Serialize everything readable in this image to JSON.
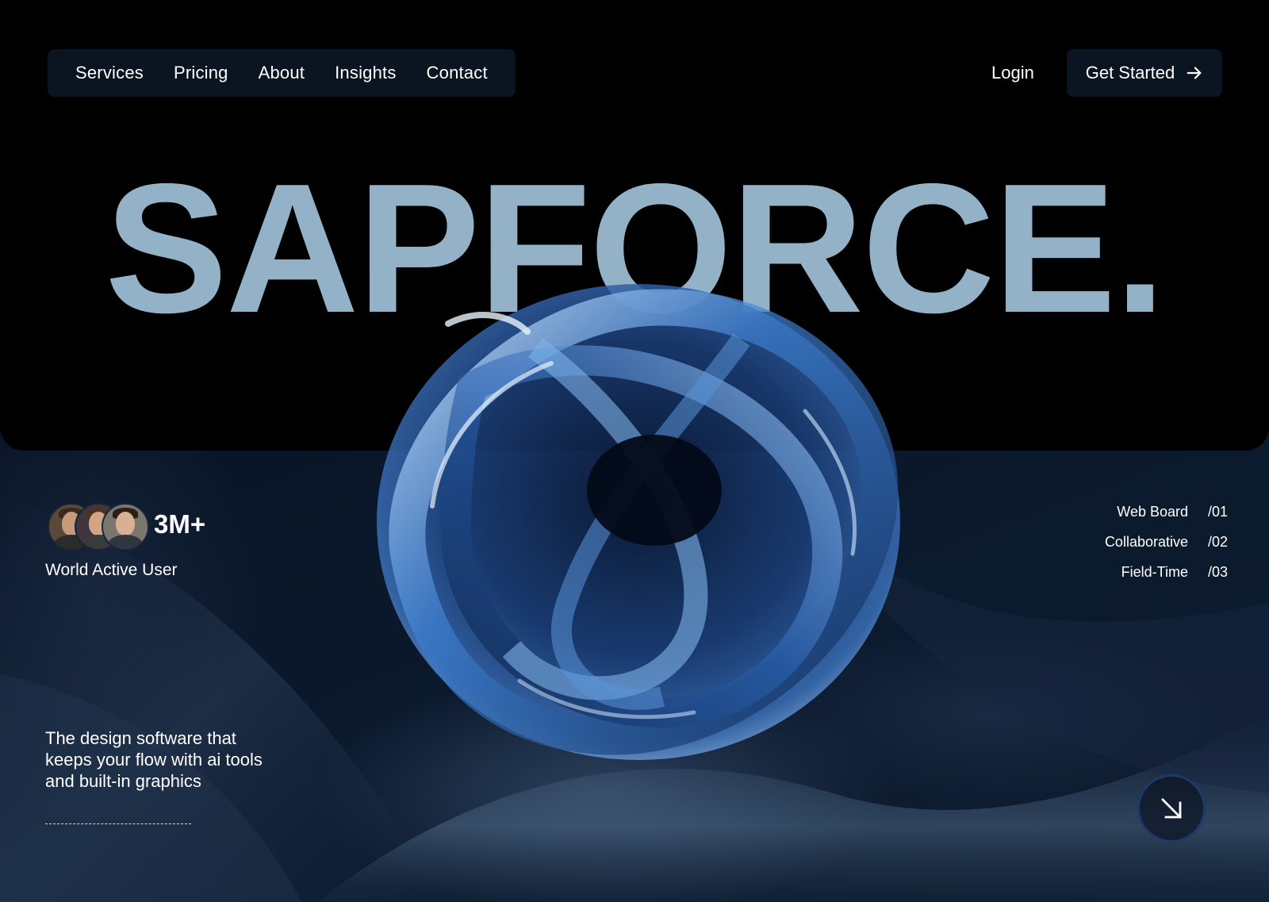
{
  "nav": {
    "items": [
      "Services",
      "Pricing",
      "About",
      "Insights",
      "Contact"
    ]
  },
  "header": {
    "login_label": "Login",
    "cta_label": "Get Started"
  },
  "hero": {
    "title": "SAPFORCE."
  },
  "stats": {
    "count": "3M+",
    "label": "World Active User"
  },
  "features": [
    {
      "label": "Web Board",
      "num": "/01"
    },
    {
      "label": "Collaborative",
      "num": "/02"
    },
    {
      "label": "Field-Time",
      "num": "/03"
    }
  ],
  "description": "The design software that keeps your flow with ai tools and built-in graphics",
  "icons": {
    "cta": "arrow-right-icon",
    "round_button": "arrow-down-right-icon"
  },
  "colors": {
    "title": "#93b2c7",
    "nav_bg": "#0b1522",
    "button_ring": "#1b3a6a"
  }
}
